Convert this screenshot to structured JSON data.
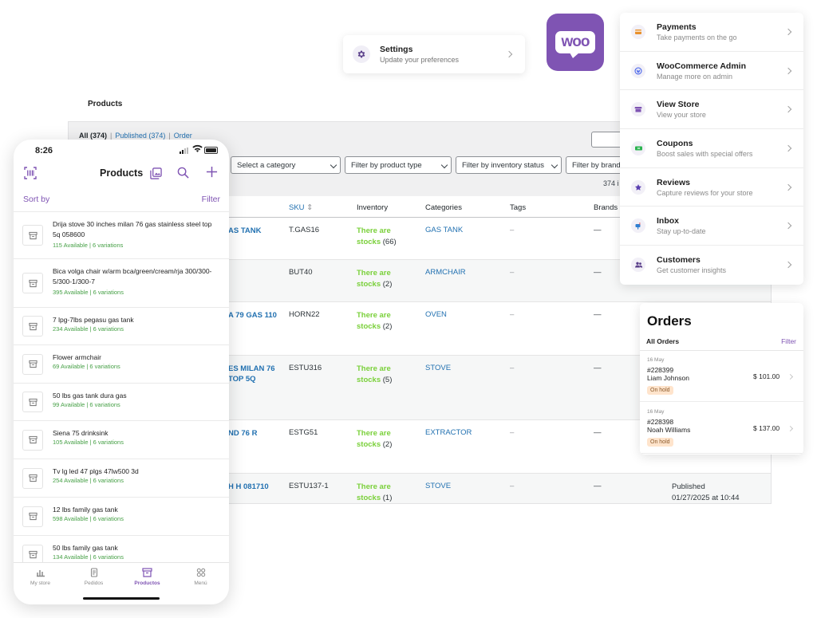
{
  "admin": {
    "title": "Products",
    "status_all": "All (374)",
    "status_published": "Published (374)",
    "status_order": "Order",
    "filters": [
      "Select a category",
      "Filter by product type",
      "Filter by inventory status",
      "Filter by brand"
    ],
    "items_count": "374 i",
    "columns": {
      "sku": "SKU",
      "inventory": "Inventory",
      "categories": "Categories",
      "tags": "Tags",
      "brands": "Brands"
    },
    "rows": [
      {
        "name": "AS TANK",
        "sku": "T.GAS16",
        "inv_status": "There are stocks",
        "inv_count": "(66)",
        "category": "GAS TANK",
        "tags": "–",
        "brands": "—",
        "published": "",
        "published_date": ""
      },
      {
        "name": "",
        "sku": "BUT40",
        "inv_status": "There are stocks",
        "inv_count": "(2)",
        "category": "ARMCHAIR",
        "tags": "–",
        "brands": "—",
        "published": "",
        "published_date": ""
      },
      {
        "name": "A 79 GAS 110",
        "sku": "HORN22",
        "inv_status": "There are stocks",
        "inv_count": "(2)",
        "category": "OVEN",
        "tags": "–",
        "brands": "—",
        "published": "",
        "published_date": ""
      },
      {
        "name": "ES MILAN 76 TOP 5Q",
        "sku": "ESTU316",
        "inv_status": "There are stocks",
        "inv_count": "(5)",
        "category": "STOVE",
        "tags": "–",
        "brands": "—",
        "published": "",
        "published_date": ""
      },
      {
        "name": "ND 76 R",
        "sku": "ESTG51",
        "inv_status": "There are stocks",
        "inv_count": "(2)",
        "category": "EXTRACTOR",
        "tags": "–",
        "brands": "—",
        "published": "",
        "published_date": ""
      },
      {
        "name": "H H 081710",
        "sku": "ESTU137-1",
        "inv_status": "There are stocks",
        "inv_count": "(1)",
        "category": "STOVE",
        "tags": "–",
        "brands": "—",
        "published": "Published",
        "published_date": "01/27/2025 at 10:44"
      }
    ]
  },
  "settings": {
    "title": "Settings",
    "subtitle": "Update your preferences"
  },
  "logo": {
    "text": "woo"
  },
  "menu": [
    {
      "title": "Payments",
      "subtitle": "Take payments on the go",
      "icon": "card-icon"
    },
    {
      "title": "WooCommerce Admin",
      "subtitle": "Manage more on admin",
      "icon": "wordpress-icon"
    },
    {
      "title": "View Store",
      "subtitle": "View your store",
      "icon": "store-icon"
    },
    {
      "title": "Coupons",
      "subtitle": "Boost sales with special offers",
      "icon": "coupon-icon"
    },
    {
      "title": "Reviews",
      "subtitle": "Capture reviews for your store",
      "icon": "star-icon"
    },
    {
      "title": "Inbox",
      "subtitle": "Stay up-to-date",
      "icon": "inbox-icon"
    },
    {
      "title": "Customers",
      "subtitle": "Get customer insights",
      "icon": "customers-icon"
    }
  ],
  "orders": {
    "title": "Orders",
    "all_label": "All Orders",
    "filter_label": "Filter",
    "items": [
      {
        "date": "16 May",
        "number": "#228399",
        "customer": "Liam Johnson",
        "status": "On hold",
        "amount": "$ 101.00"
      },
      {
        "date": "16 May",
        "number": "#228398",
        "customer": "Noah Williams",
        "status": "On hold",
        "amount": "$ 137.00"
      }
    ]
  },
  "phone": {
    "time": "8:26",
    "title": "Products",
    "sort_label": "Sort by",
    "filter_label": "Filter",
    "products": [
      {
        "name": "Drija stove 30 inches milan 76 gas stainless steel top 5q 058600",
        "availability": "115 Available | 6 variations"
      },
      {
        "name": "Bica volga chair w/arm bca/green/cream/rja 300/300-5/300-1/300-7",
        "availability": "395 Available | 6 variations"
      },
      {
        "name": "7 lpg-7lbs pegasu gas tank",
        "availability": "234 Available | 6 variations"
      },
      {
        "name": "Flower armchair",
        "availability": "69 Available | 6 variations"
      },
      {
        "name": "50 lbs gas tank dura gas",
        "availability": "99 Available | 6 variations"
      },
      {
        "name": "Siena 75 drinksink",
        "availability": "105 Available | 6 variations"
      },
      {
        "name": "Tv lg led 47 plgs 47lw500 3d",
        "availability": "254 Available | 6 variations"
      },
      {
        "name": "12 lbs family gas tank",
        "availability": "598 Available | 6 variations"
      },
      {
        "name": "50 lbs family gas tank",
        "availability": "134 Available | 6 variations"
      }
    ],
    "tabs": [
      {
        "label": "My store",
        "icon": "chart-icon"
      },
      {
        "label": "Pedidos",
        "icon": "orders-icon"
      },
      {
        "label": "Productos",
        "icon": "box-icon"
      },
      {
        "label": "Menú",
        "icon": "menu-icon"
      }
    ]
  },
  "colors": {
    "accent": "#7f54b3",
    "link": "#2271b1",
    "stock": "#7ad03a"
  }
}
